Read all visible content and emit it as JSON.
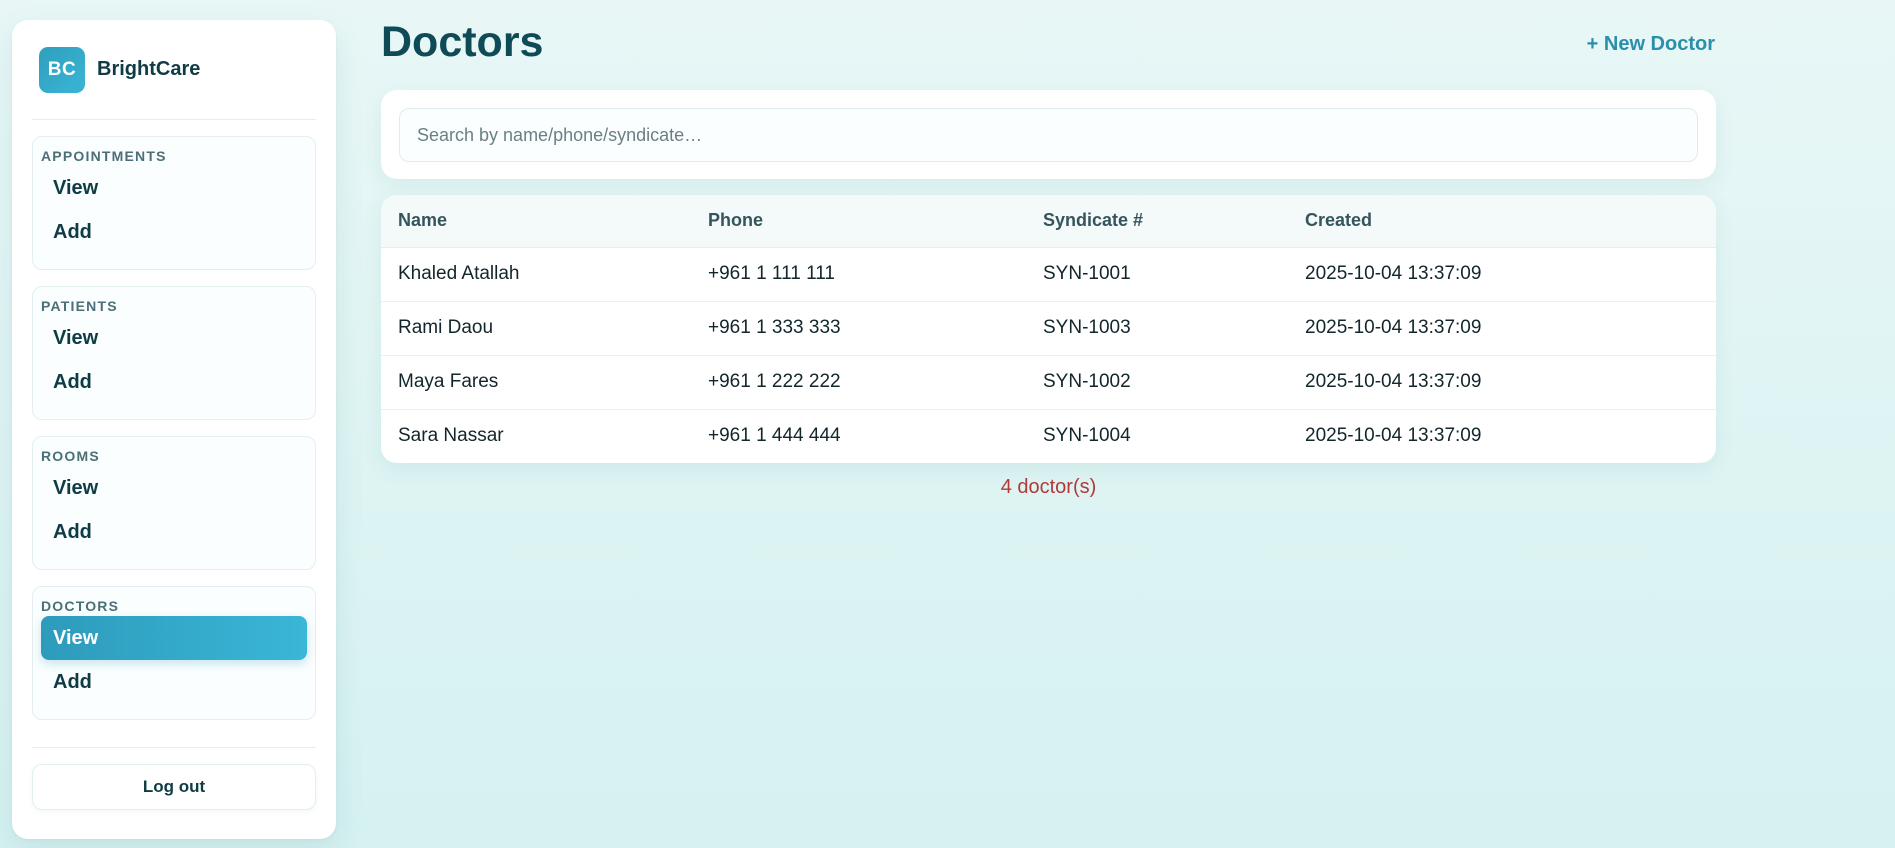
{
  "brand": {
    "logo": "BC",
    "name": "BrightCare"
  },
  "sidebar": {
    "sections": [
      {
        "title": "APPOINTMENTS",
        "items": [
          "View",
          "Add"
        ]
      },
      {
        "title": "PATIENTS",
        "items": [
          "View",
          "Add"
        ]
      },
      {
        "title": "ROOMS",
        "items": [
          "View",
          "Add"
        ]
      },
      {
        "title": "DOCTORS",
        "items": [
          "View",
          "Add"
        ],
        "active": "View"
      }
    ],
    "logout_label": "Log out"
  },
  "header": {
    "title": "Doctors",
    "new_button": "+ New Doctor"
  },
  "search": {
    "placeholder": "Search by name/phone/syndicate…",
    "value": ""
  },
  "table": {
    "columns": [
      "Name",
      "Phone",
      "Syndicate #",
      "Created"
    ],
    "rows": [
      [
        "Khaled Atallah",
        "+961 1 111 111",
        "SYN-1001",
        "2025-10-04 13:37:09"
      ],
      [
        "Rami Daou",
        "+961 1 333 333",
        "SYN-1003",
        "2025-10-04 13:37:09"
      ],
      [
        "Maya Fares",
        "+961 1 222 222",
        "SYN-1002",
        "2025-10-04 13:37:09"
      ],
      [
        "Sara Nassar",
        "+961 1 444 444",
        "SYN-1004",
        "2025-10-04 13:37:09"
      ]
    ]
  },
  "footer": {
    "count": "4 doctor(s)"
  },
  "colors": {
    "accent": "#2e9bbb",
    "count_text": "#b03a3a",
    "heading": "#0f4b57"
  }
}
